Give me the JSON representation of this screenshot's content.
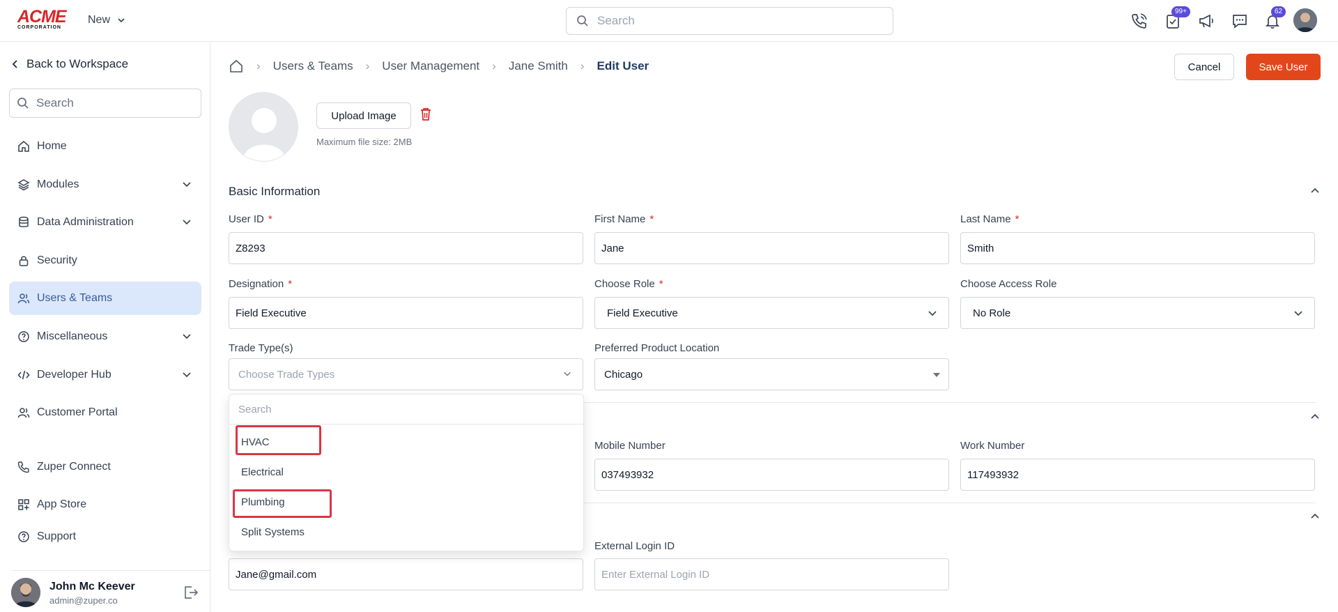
{
  "app": {
    "logo_main": "ACME",
    "logo_sub": "CORPORATION",
    "new_label": "New",
    "search_placeholder": "Search",
    "tasks_badge": "99+",
    "notifications_badge": "62"
  },
  "sidebar": {
    "back_label": "Back to Workspace",
    "search_placeholder": "Search",
    "items": [
      {
        "label": "Home"
      },
      {
        "label": "Modules"
      },
      {
        "label": "Data Administration"
      },
      {
        "label": "Security"
      },
      {
        "label": "Users & Teams"
      },
      {
        "label": "Miscellaneous"
      },
      {
        "label": "Developer Hub"
      },
      {
        "label": "Customer Portal"
      },
      {
        "label": "Zuper Connect"
      },
      {
        "label": "App Store"
      },
      {
        "label": "Support"
      }
    ],
    "user": {
      "name": "John Mc Keever",
      "email": "admin@zuper.co"
    }
  },
  "breadcrumb": {
    "items": [
      "Users & Teams",
      "User Management",
      "Jane Smith"
    ],
    "current": "Edit User"
  },
  "actions": {
    "cancel": "Cancel",
    "save": "Save User"
  },
  "profile": {
    "upload_label": "Upload Image",
    "hint": "Maximum file size: 2MB"
  },
  "basic_info": {
    "title": "Basic Information",
    "user_id": {
      "label": "User ID",
      "value": "Z8293"
    },
    "first_name": {
      "label": "First Name",
      "value": "Jane"
    },
    "last_name": {
      "label": "Last Name",
      "value": "Smith"
    },
    "designation": {
      "label": "Designation",
      "value": "Field Executive"
    },
    "role": {
      "label": "Choose Role",
      "value": "Field Executive"
    },
    "access_role": {
      "label": "Choose Access Role",
      "value": "No Role"
    },
    "trade_types": {
      "label": "Trade Type(s)",
      "placeholder": "Choose Trade Types"
    },
    "product_location": {
      "label": "Preferred Product Location",
      "value": "Chicago"
    }
  },
  "contact": {
    "mobile": {
      "label": "Mobile Number",
      "value": "037493932"
    },
    "work": {
      "label": "Work Number",
      "value": "117493932"
    }
  },
  "login": {
    "email_value": "Jane@gmail.com",
    "external": {
      "label": "External Login ID",
      "placeholder": "Enter External Login ID"
    }
  },
  "trade_dropdown": {
    "search_placeholder": "Search",
    "options": [
      "HVAC",
      "Electrical",
      "Plumbing",
      "Split Systems"
    ],
    "highlighted": [
      "HVAC",
      "Plumbing"
    ],
    "highlight_color": "#dc3545"
  },
  "colors": {
    "accent": "#e2471b",
    "active_nav": "#dbe8fb",
    "badge": "#5b4bdb"
  }
}
